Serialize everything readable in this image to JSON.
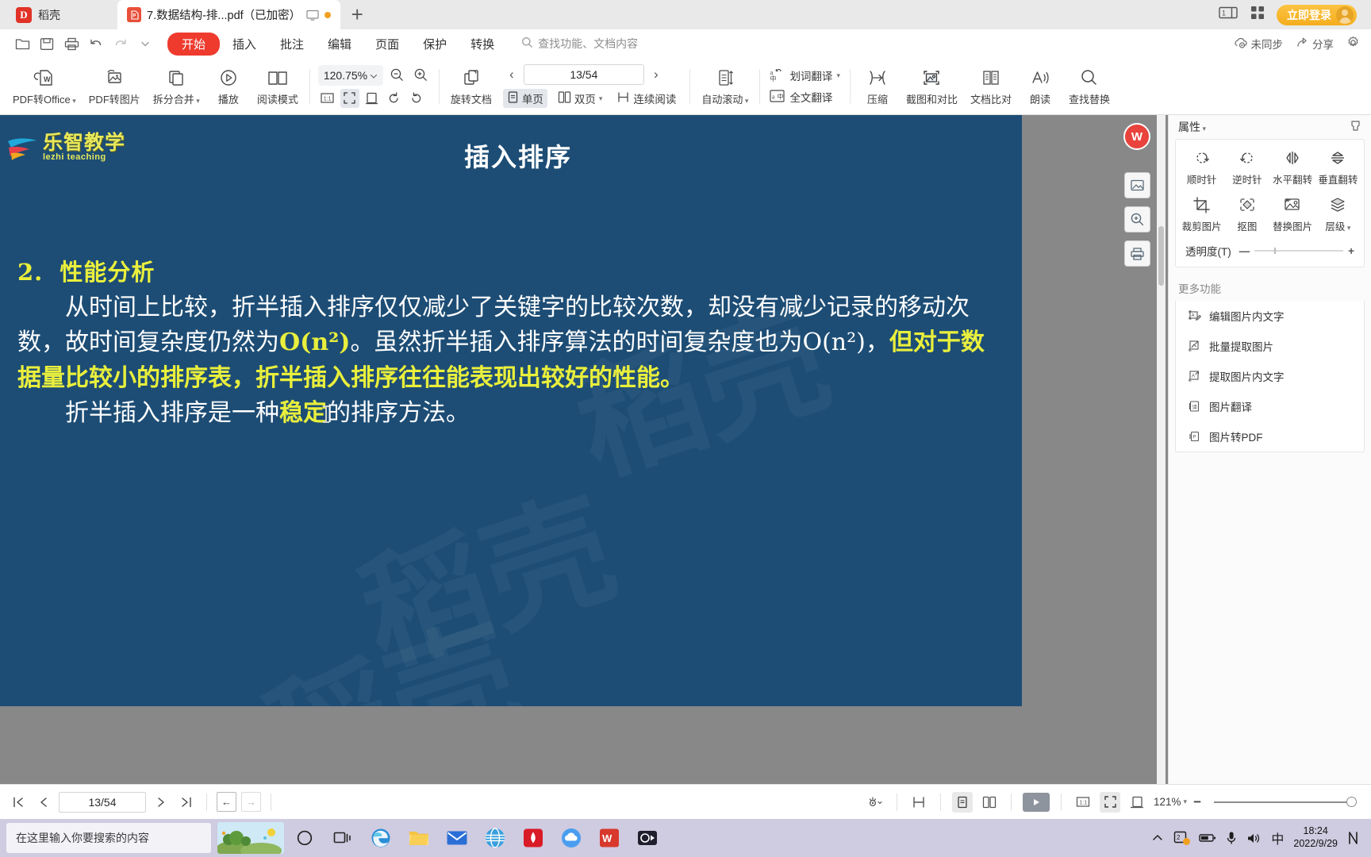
{
  "tabbar": {
    "cloud_label": "稻壳",
    "cloud_icon": "wps-cloud-icon",
    "doc_tab": {
      "title": "7.数据结构-排...pdf（已加密）",
      "badge": "P",
      "monitor_icon": "monitor-icon",
      "modified_dot": "unsaved-dot"
    },
    "new_tab": "+",
    "window_icon_1": "restore-window-icon",
    "window_icon_2": "apps-grid-icon",
    "login_label": "立即登录"
  },
  "menubar": {
    "quick": [
      {
        "name": "open-file-icon"
      },
      {
        "name": "save-file-icon"
      },
      {
        "name": "print-icon"
      },
      {
        "name": "undo-icon"
      },
      {
        "name": "redo-icon"
      },
      {
        "name": "chevron-down-icon"
      }
    ],
    "items": [
      {
        "label": "开始",
        "active": true
      },
      {
        "label": "插入",
        "active": false
      },
      {
        "label": "批注",
        "active": false
      },
      {
        "label": "编辑",
        "active": false
      },
      {
        "label": "页面",
        "active": false
      },
      {
        "label": "保护",
        "active": false
      },
      {
        "label": "转换",
        "active": false
      }
    ],
    "search_placeholder": "查找功能、文档内容",
    "right": [
      {
        "label": "未同步",
        "icon": "cloud-off-icon"
      },
      {
        "label": "分享",
        "icon": "share-icon"
      },
      {
        "label": "",
        "icon": "gear-icon"
      }
    ]
  },
  "ribbon": {
    "buttons": [
      {
        "label": "PDF转Office",
        "icon": "pdf-to-office-icon",
        "caret": true
      },
      {
        "label": "PDF转图片",
        "icon": "pdf-to-image-icon",
        "caret": false
      },
      {
        "label": "拆分合并",
        "icon": "split-merge-icon",
        "caret": true
      },
      {
        "label": "播放",
        "icon": "play-circle-icon",
        "caret": false
      },
      {
        "label": "阅读模式",
        "icon": "book-open-icon",
        "caret": false
      }
    ],
    "zoom": {
      "value": "120.75%",
      "zoom_out_icon": "zoom-out-icon",
      "zoom_in_icon": "zoom-in-icon",
      "fit_actual_icon": "actual-size-icon",
      "fit_page_icon": "fit-page-icon",
      "fit_width_icon": "fit-width-icon",
      "rotate_ccw_icon": "rotate-ccw-icon",
      "rotate_cw_icon": "rotate-cw-icon"
    },
    "rotate_doc": {
      "label": "旋转文档",
      "icon": "rotate-document-icon"
    },
    "page_nav": {
      "value": "13/54",
      "prev_icon": "chevron-left-icon",
      "next_icon": "chevron-right-icon"
    },
    "view_modes": [
      {
        "label": "单页",
        "icon": "single-page-icon",
        "selected": true,
        "caret": false
      },
      {
        "label": "双页",
        "icon": "two-page-icon",
        "selected": false,
        "caret": true
      },
      {
        "label": "连续阅读",
        "icon": "continuous-scroll-icon",
        "selected": false,
        "caret": false
      }
    ],
    "auto_scroll": {
      "label": "自动滚动",
      "icon": "auto-scroll-icon",
      "caret": true
    },
    "translate": [
      {
        "label": "划词翻译",
        "icon": "select-translate-icon",
        "caret": true
      },
      {
        "label": "全文翻译",
        "icon": "full-translate-icon",
        "caret": false
      }
    ],
    "tools": [
      {
        "label": "压缩",
        "icon": "compress-icon"
      },
      {
        "label": "截图和对比",
        "icon": "screenshot-compare-icon"
      },
      {
        "label": "文档比对",
        "icon": "document-compare-icon"
      },
      {
        "label": "朗读",
        "icon": "read-aloud-icon"
      },
      {
        "label": "查找替换",
        "icon": "find-replace-icon"
      }
    ]
  },
  "document": {
    "brand": {
      "cn": "乐智教学",
      "en": "lezhi teaching"
    },
    "title": "插入排序",
    "heading_num": "2.",
    "heading_text": "性能分析",
    "para1": {
      "seg1": "从时间上比较，折半插入排序仅仅减少了关键字的比较次数，却没有减少记录的移动次数，故时间复杂度仍然为",
      "seg2_hl": "O(n²)",
      "seg3": "。虽然折半插入排序算法的时间复杂度也为O(n²)，",
      "seg4_hl": "但对于数据量比较小的排序表，折半插入排序往往能表现出较好的性能。"
    },
    "para2": {
      "seg1": "折半插入排序是一种",
      "seg2_hl": "稳定",
      "seg3": "的排序方法。"
    },
    "watermarks": [
      "稻壳",
      "稻壳",
      "稻壳"
    ],
    "float_tools": [
      {
        "icon": "snapshot-icon"
      },
      {
        "icon": "magnifier-icon"
      },
      {
        "icon": "print-page-icon"
      }
    ],
    "wps_badge": "W"
  },
  "right_panel": {
    "title": "属性",
    "pin_icon": "pin-icon",
    "tools": [
      {
        "label": "顺时针",
        "icon": "rotate-clockwise-icon"
      },
      {
        "label": "逆时针",
        "icon": "rotate-counterclockwise-icon"
      },
      {
        "label": "水平翻转",
        "icon": "flip-horizontal-icon"
      },
      {
        "label": "垂直翻转",
        "icon": "flip-vertical-icon"
      },
      {
        "label": "裁剪图片",
        "icon": "crop-image-icon"
      },
      {
        "label": "抠图",
        "icon": "cutout-icon"
      },
      {
        "label": "替换图片",
        "icon": "replace-image-icon"
      },
      {
        "label": "层级",
        "icon": "layer-order-icon"
      }
    ],
    "transparency_label": "透明度(T)",
    "more_title": "更多功能",
    "more_items": [
      {
        "label": "编辑图片内文字",
        "icon": "edit-image-text-icon"
      },
      {
        "label": "批量提取图片",
        "icon": "batch-extract-image-icon"
      },
      {
        "label": "提取图片内文字",
        "icon": "extract-image-text-icon"
      },
      {
        "label": "图片翻译",
        "icon": "image-translate-icon"
      },
      {
        "label": "图片转PDF",
        "icon": "image-to-pdf-icon"
      }
    ]
  },
  "statusbar": {
    "first_icon": "first-page-icon",
    "prev_icon": "prev-page-icon",
    "page_value": "13/54",
    "next_icon": "next-page-icon",
    "last_icon": "last-page-icon",
    "back_icon": "go-back-icon",
    "forward_icon": "go-forward-icon",
    "eye_icon": "view-mode-icon",
    "fit_icon": "fit-visible-icon",
    "single_page_icon": "single-page-icon",
    "two_page_icon": "two-page-icon",
    "play_icon": "slideshow-icon",
    "actual_size_icon": "actual-size-icon",
    "fit_page_icon": "fit-page-icon",
    "fit_width_icon": "fit-width-icon",
    "zoom_value": "121%",
    "zoom_minus": "−"
  },
  "taskbar": {
    "search_placeholder": "在这里输入你要搜索的内容",
    "items": [
      {
        "name": "weather-widget"
      },
      {
        "name": "cortana-icon"
      },
      {
        "name": "task-view-icon"
      },
      {
        "name": "edge-icon"
      },
      {
        "name": "file-explorer-icon"
      },
      {
        "name": "mail-icon"
      },
      {
        "name": "browser-icon"
      },
      {
        "name": "huawei-icon"
      },
      {
        "name": "cloud-app-icon"
      },
      {
        "name": "wps-icon"
      },
      {
        "name": "screen-recorder-icon"
      }
    ],
    "tray": {
      "chevron_icon": "show-hidden-icons",
      "onedrive_icon": "sync-icon",
      "battery_icon": "battery-icon",
      "mic_icon": "microphone-icon",
      "volume_icon": "volume-icon",
      "ime_label": "中",
      "time": "18:24",
      "date": "2022/9/29",
      "notification_icon": "notifications-icon"
    }
  },
  "colors": {
    "accent_red": "#ee3b2e",
    "login_orange": "#f5ad1e",
    "slide_bg": "#1d4d75",
    "highlight_yellow": "#e9ef3c",
    "taskbar_bg": "#cfcbe0"
  }
}
